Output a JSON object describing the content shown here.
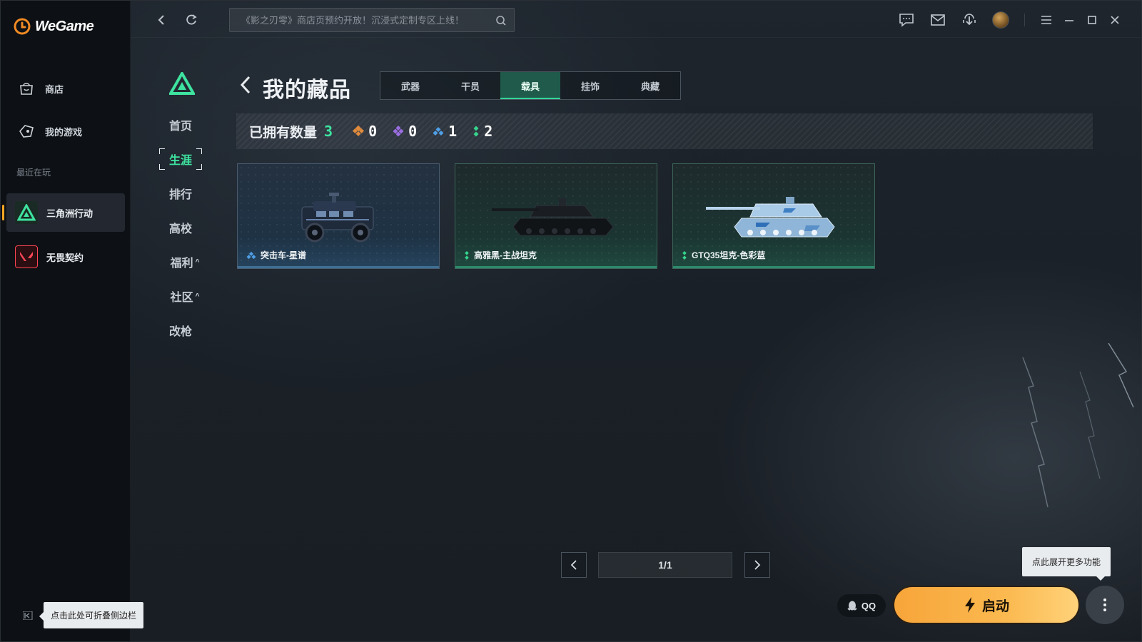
{
  "app": {
    "name": "WeGame"
  },
  "sidebar": {
    "items": [
      {
        "label": "商店",
        "icon": "shop-bag-icon"
      },
      {
        "label": "我的游戏",
        "icon": "game-controller-icon"
      }
    ],
    "recent_label": "最近在玩",
    "games": [
      {
        "label": "三角洲行动",
        "icon": "delta-force-icon",
        "active": true
      },
      {
        "label": "无畏契约",
        "icon": "valorant-icon",
        "active": false
      }
    ],
    "collapse_tooltip": "点击此处可折叠侧边栏"
  },
  "topbar": {
    "search_placeholder": "《影之刃零》商店页预约开放！沉浸式定制专区上线！"
  },
  "game_nav": {
    "items": [
      {
        "label": "首页",
        "active": false,
        "caret": ""
      },
      {
        "label": "生涯",
        "active": true,
        "caret": ""
      },
      {
        "label": "排行",
        "active": false,
        "caret": ""
      },
      {
        "label": "高校",
        "active": false,
        "caret": ""
      },
      {
        "label": "福利",
        "active": false,
        "caret": "^"
      },
      {
        "label": "社区",
        "active": false,
        "caret": "^"
      },
      {
        "label": "改枪",
        "active": false,
        "caret": ""
      }
    ]
  },
  "collection": {
    "title": "我的藏品",
    "tabs": [
      "武器",
      "干员",
      "载具",
      "挂饰",
      "典藏"
    ],
    "active_tab": 2,
    "owned_label": "已拥有数量",
    "owned_total": "3",
    "rarity_counts": [
      {
        "tier": "orange",
        "color": "#e08a3c",
        "value": "0"
      },
      {
        "tier": "purple",
        "color": "#9a6ee0",
        "value": "0"
      },
      {
        "tier": "blue",
        "color": "#4f9fe6",
        "value": "1"
      },
      {
        "tier": "green",
        "color": "#36d48d",
        "value": "2"
      }
    ],
    "items": [
      {
        "name": "突击车-星谱",
        "rarity": "blue",
        "vehicle": "assault-vehicle"
      },
      {
        "name": "高雅黑-主战坦克",
        "rarity": "green",
        "vehicle": "black-tank"
      },
      {
        "name": "GTQ35坦克-色彩蓝",
        "rarity": "green",
        "vehicle": "blue-camo-tank"
      }
    ],
    "page": "1/1"
  },
  "bottom": {
    "qq_label": "QQ",
    "launch_label": "启动",
    "more_tooltip": "点此展开更多功能"
  },
  "colors": {
    "accent_green": "#3ee3a0",
    "launch_orange": "#f7a53a"
  }
}
